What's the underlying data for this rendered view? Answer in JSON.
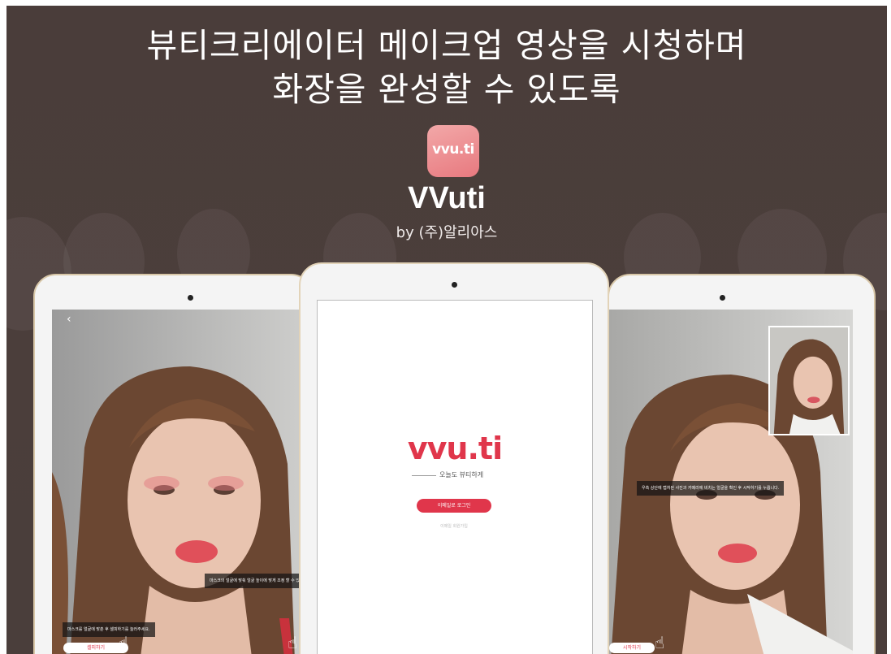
{
  "headline": {
    "line1": "뷰티크리에이터 메이크업 영상을 시청하며",
    "line2": "화장을 완성할 수 있도록"
  },
  "app": {
    "icon_text": "vvu.ti",
    "name": "VVuti",
    "developer": "by (주)알리아스"
  },
  "tablet_left": {
    "back_glyph": "‹",
    "caption_top": "마스크의 얼굴에 맞춰 얼굴 높이에 맞게 조정 할 수 있습니다.",
    "caption_bottom": "마스크를 얼굴에 맞춘 후 셀피하기를 눌러주세요.",
    "button_label": "셀피하기"
  },
  "tablet_center": {
    "wordmark": "vvu.ti",
    "tagline": "오늘도 뷰티하게",
    "login_button": "이메일로 로그인",
    "signup_link": "이메일 회원가입"
  },
  "tablet_right": {
    "caption": "우측 상단에 캡처된 사진과 카메라에 비치는 얼굴을 확인 후 시작하기를 누릅니다.",
    "button_label": "시작하기"
  },
  "colors": {
    "background": "#4a3e3b",
    "accent": "#e0364b",
    "icon_gradient_start": "#f2a8a8",
    "icon_gradient_end": "#e8797f",
    "tablet_frame": "#d8c7a8"
  },
  "icons": [
    "back-arrow-icon",
    "hand-pointer-icon",
    "app-icon",
    "camera-icon"
  ]
}
